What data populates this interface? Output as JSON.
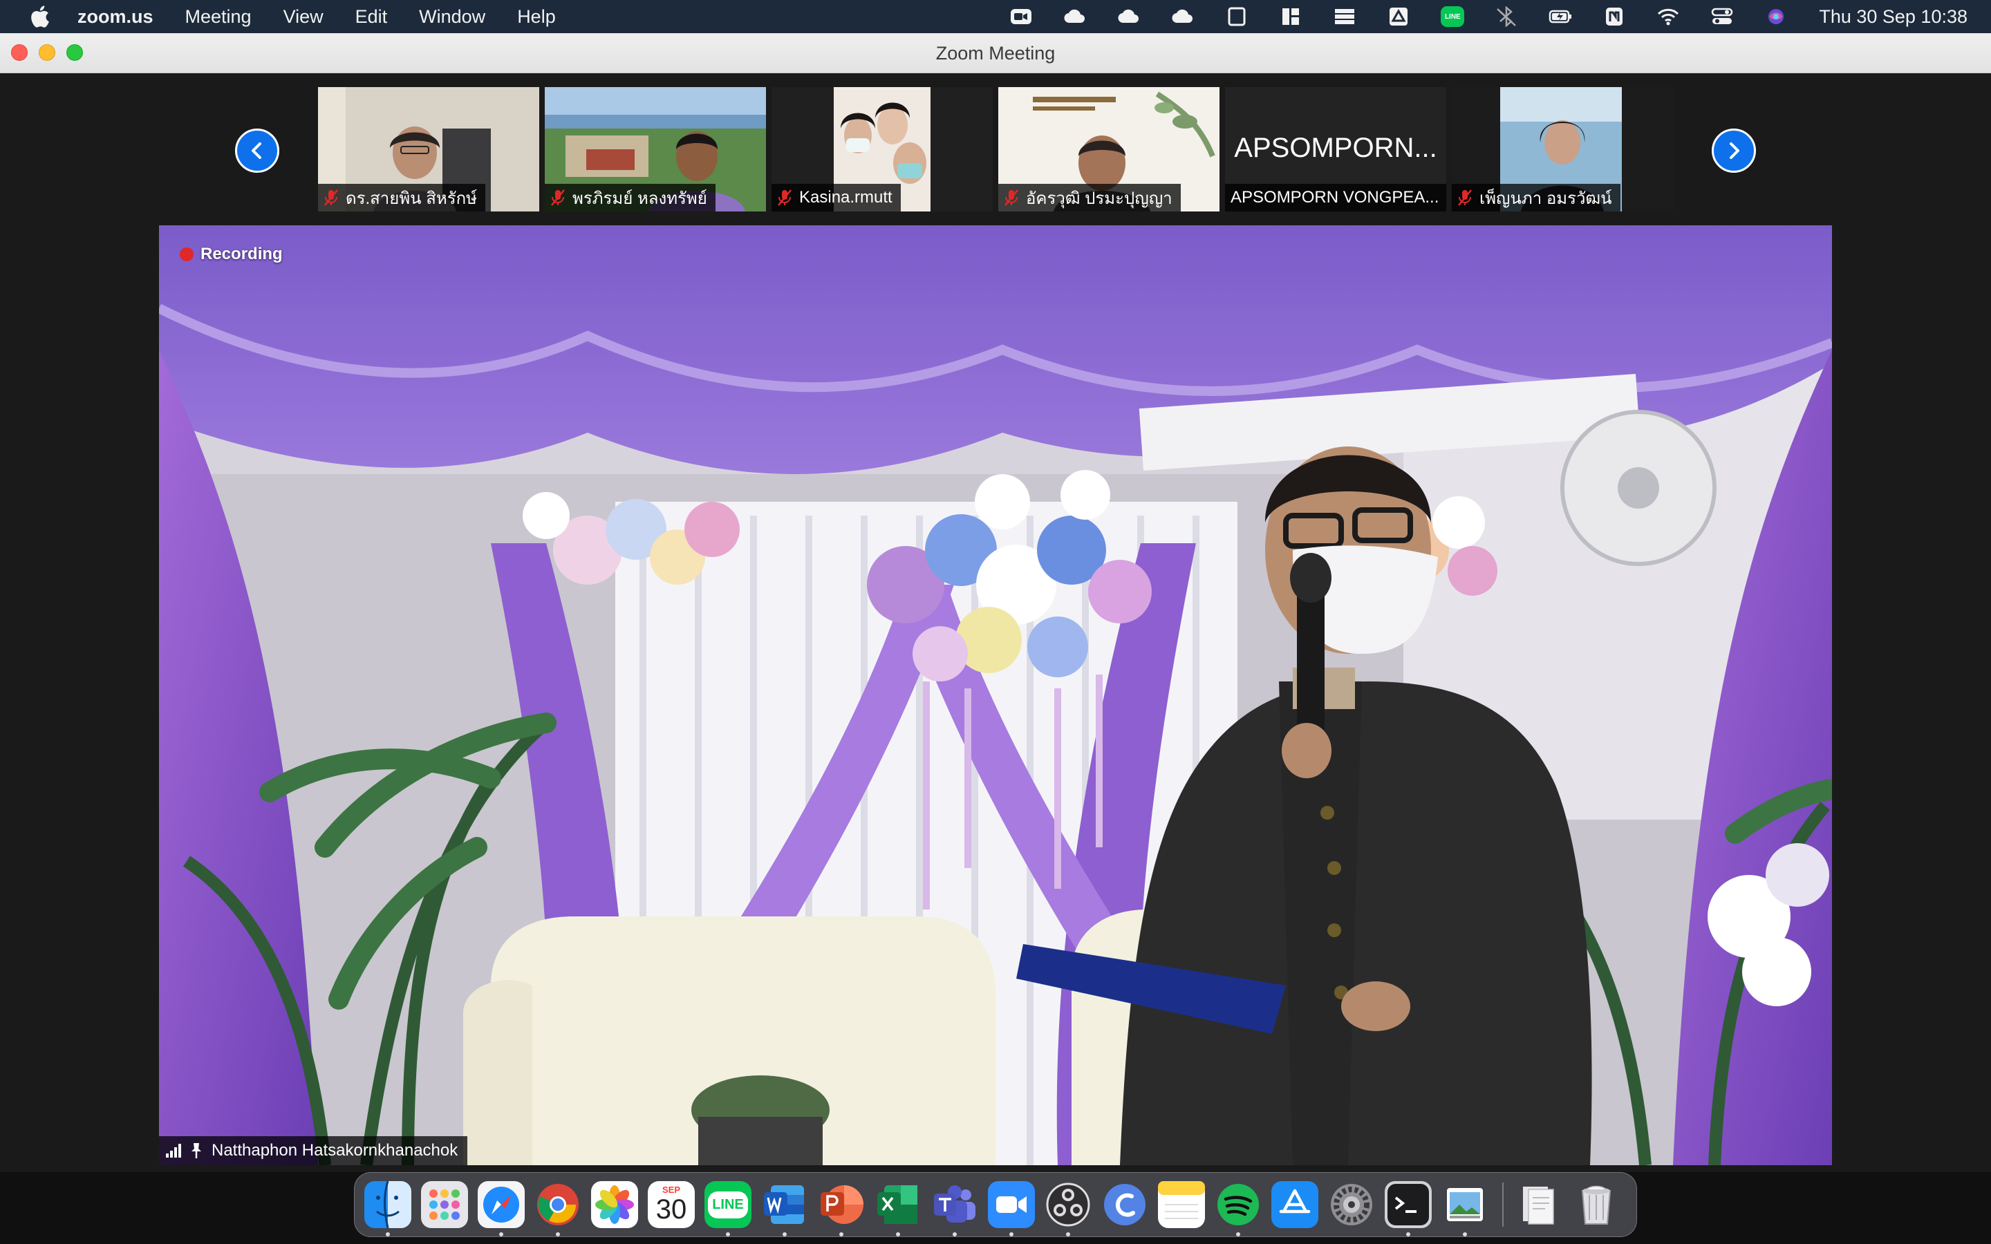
{
  "menubar": {
    "app_name": "zoom.us",
    "items": [
      "Meeting",
      "View",
      "Edit",
      "Window",
      "Help"
    ],
    "clock": "Thu 30 Sep  10:38",
    "line_label": "LINE"
  },
  "window": {
    "title": "Zoom Meeting"
  },
  "participants": [
    {
      "name": "ดร.สายพิน  สิหรักษ์",
      "muted": true
    },
    {
      "name": "พรภิรมย์ หลงทรัพย์",
      "muted": true
    },
    {
      "name": "Kasina.rmutt",
      "muted": true
    },
    {
      "name": "อัครวุฒิ ปรมะปุญญา",
      "muted": true
    },
    {
      "name": "APSOMPORN VONGPEA...",
      "muted": false,
      "display_name": "APSOMPORN..."
    },
    {
      "name": "เพ็ญนภา  อมรวัฒน์",
      "muted": true
    }
  ],
  "main_video": {
    "recording_label": "Recording",
    "speaker_name": "Natthaphon Hatsakornkhanachok"
  },
  "dock": {
    "calendar_month": "SEP",
    "calendar_day": "30",
    "line_label": "LINE"
  },
  "colors": {
    "zoom_blue": "#0e71eb",
    "recording_red": "#e02828",
    "active_speaker": "#f5b324"
  }
}
